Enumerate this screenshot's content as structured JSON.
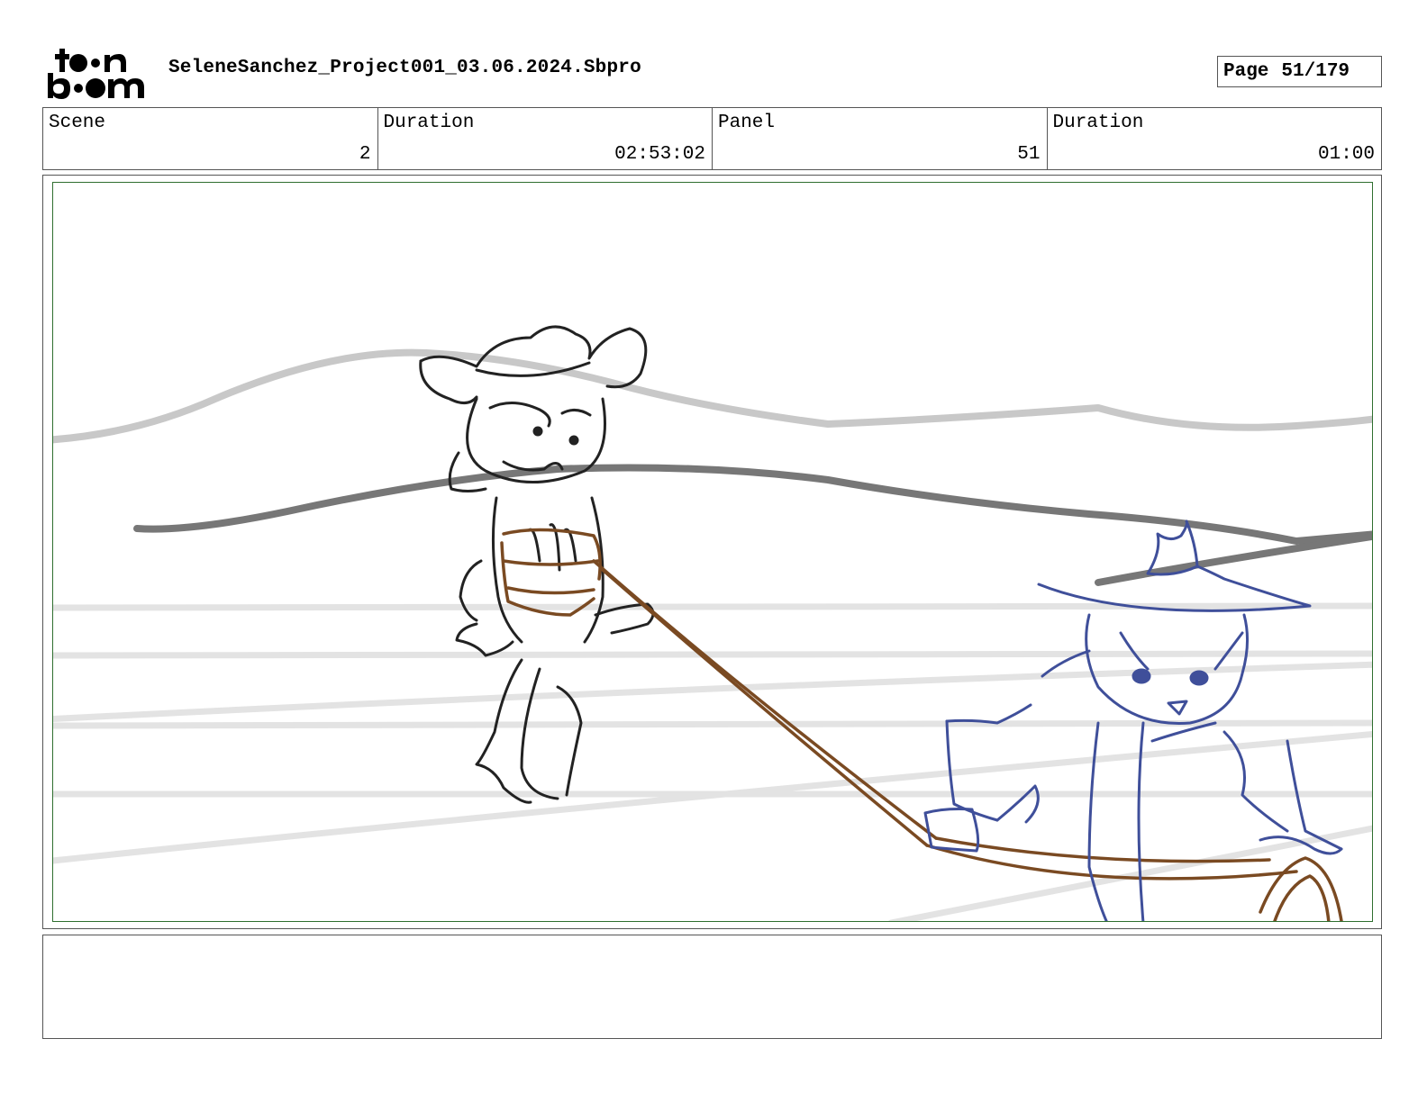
{
  "logo": {
    "line1": "toon",
    "line2": "boom"
  },
  "project_title": "SeleneSanchez_Project001_03.06.2024.Sbpro",
  "page": {
    "label": "Page",
    "value": "51/179"
  },
  "info": {
    "scene_label": "Scene",
    "scene_value": "2",
    "scene_duration_label": "Duration",
    "scene_duration_value": "02:53:02",
    "panel_label": "Panel",
    "panel_value": "51",
    "panel_duration_label": "Duration",
    "panel_duration_value": "01:00"
  },
  "notes": {
    "text": ""
  },
  "colors": {
    "panel_border": "#2f6f2f",
    "sketch_dark": "#222222",
    "rope": "#7a4a22",
    "cowgirl_blue": "#3f4f9a",
    "hill_light": "#c8c8c8",
    "hill_dark": "#777777",
    "fence": "#e3e3e3"
  }
}
